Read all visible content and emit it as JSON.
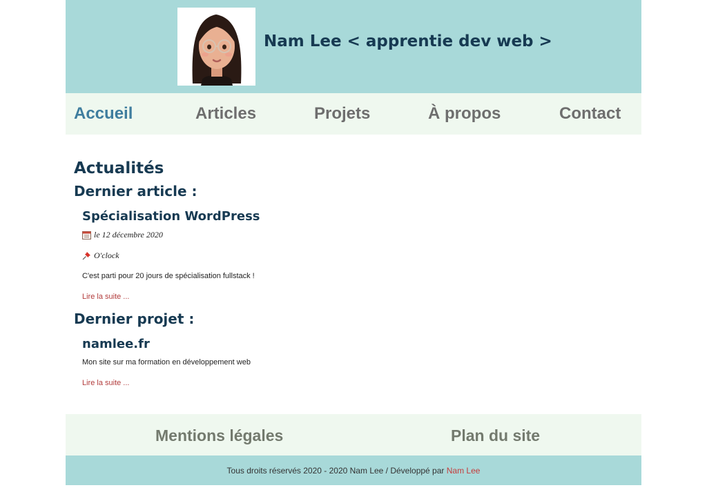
{
  "header": {
    "title": "Nam Lee < apprentie dev web >",
    "avatar_icon": "memoji-avatar"
  },
  "nav": {
    "items": [
      {
        "label": "Accueil",
        "active": true
      },
      {
        "label": "Articles",
        "active": false
      },
      {
        "label": "Projets",
        "active": false
      },
      {
        "label": "À propos",
        "active": false
      },
      {
        "label": "Contact",
        "active": false
      }
    ]
  },
  "main": {
    "heading": "Actualités",
    "article_section": {
      "heading": "Dernier article :",
      "title": "Spécialisation WordPress",
      "date": "le 12 décembre 2020",
      "date_icon": "calendar-icon",
      "tag": "O'clock",
      "tag_icon": "pushpin-icon",
      "excerpt": "C'est parti pour 20 jours de spécialisation fullstack !",
      "read_more": "Lire la suite ..."
    },
    "project_section": {
      "heading": "Dernier projet :",
      "title": "namlee.fr",
      "excerpt": "Mon site sur ma formation en développement web",
      "read_more": "Lire la suite ..."
    }
  },
  "footer": {
    "links": [
      "Mentions légales",
      "Plan du site"
    ],
    "copyright_prefix": "Tous droits réservés 2020 - 2020 Nam Lee / Développé par ",
    "copyright_author": "Nam Lee"
  },
  "colors": {
    "header_bg": "#a8d9d9",
    "nav_bg": "#eff8ef",
    "heading": "#173a52",
    "active_link": "#3f7d9e",
    "link_red": "#b23b3b"
  }
}
